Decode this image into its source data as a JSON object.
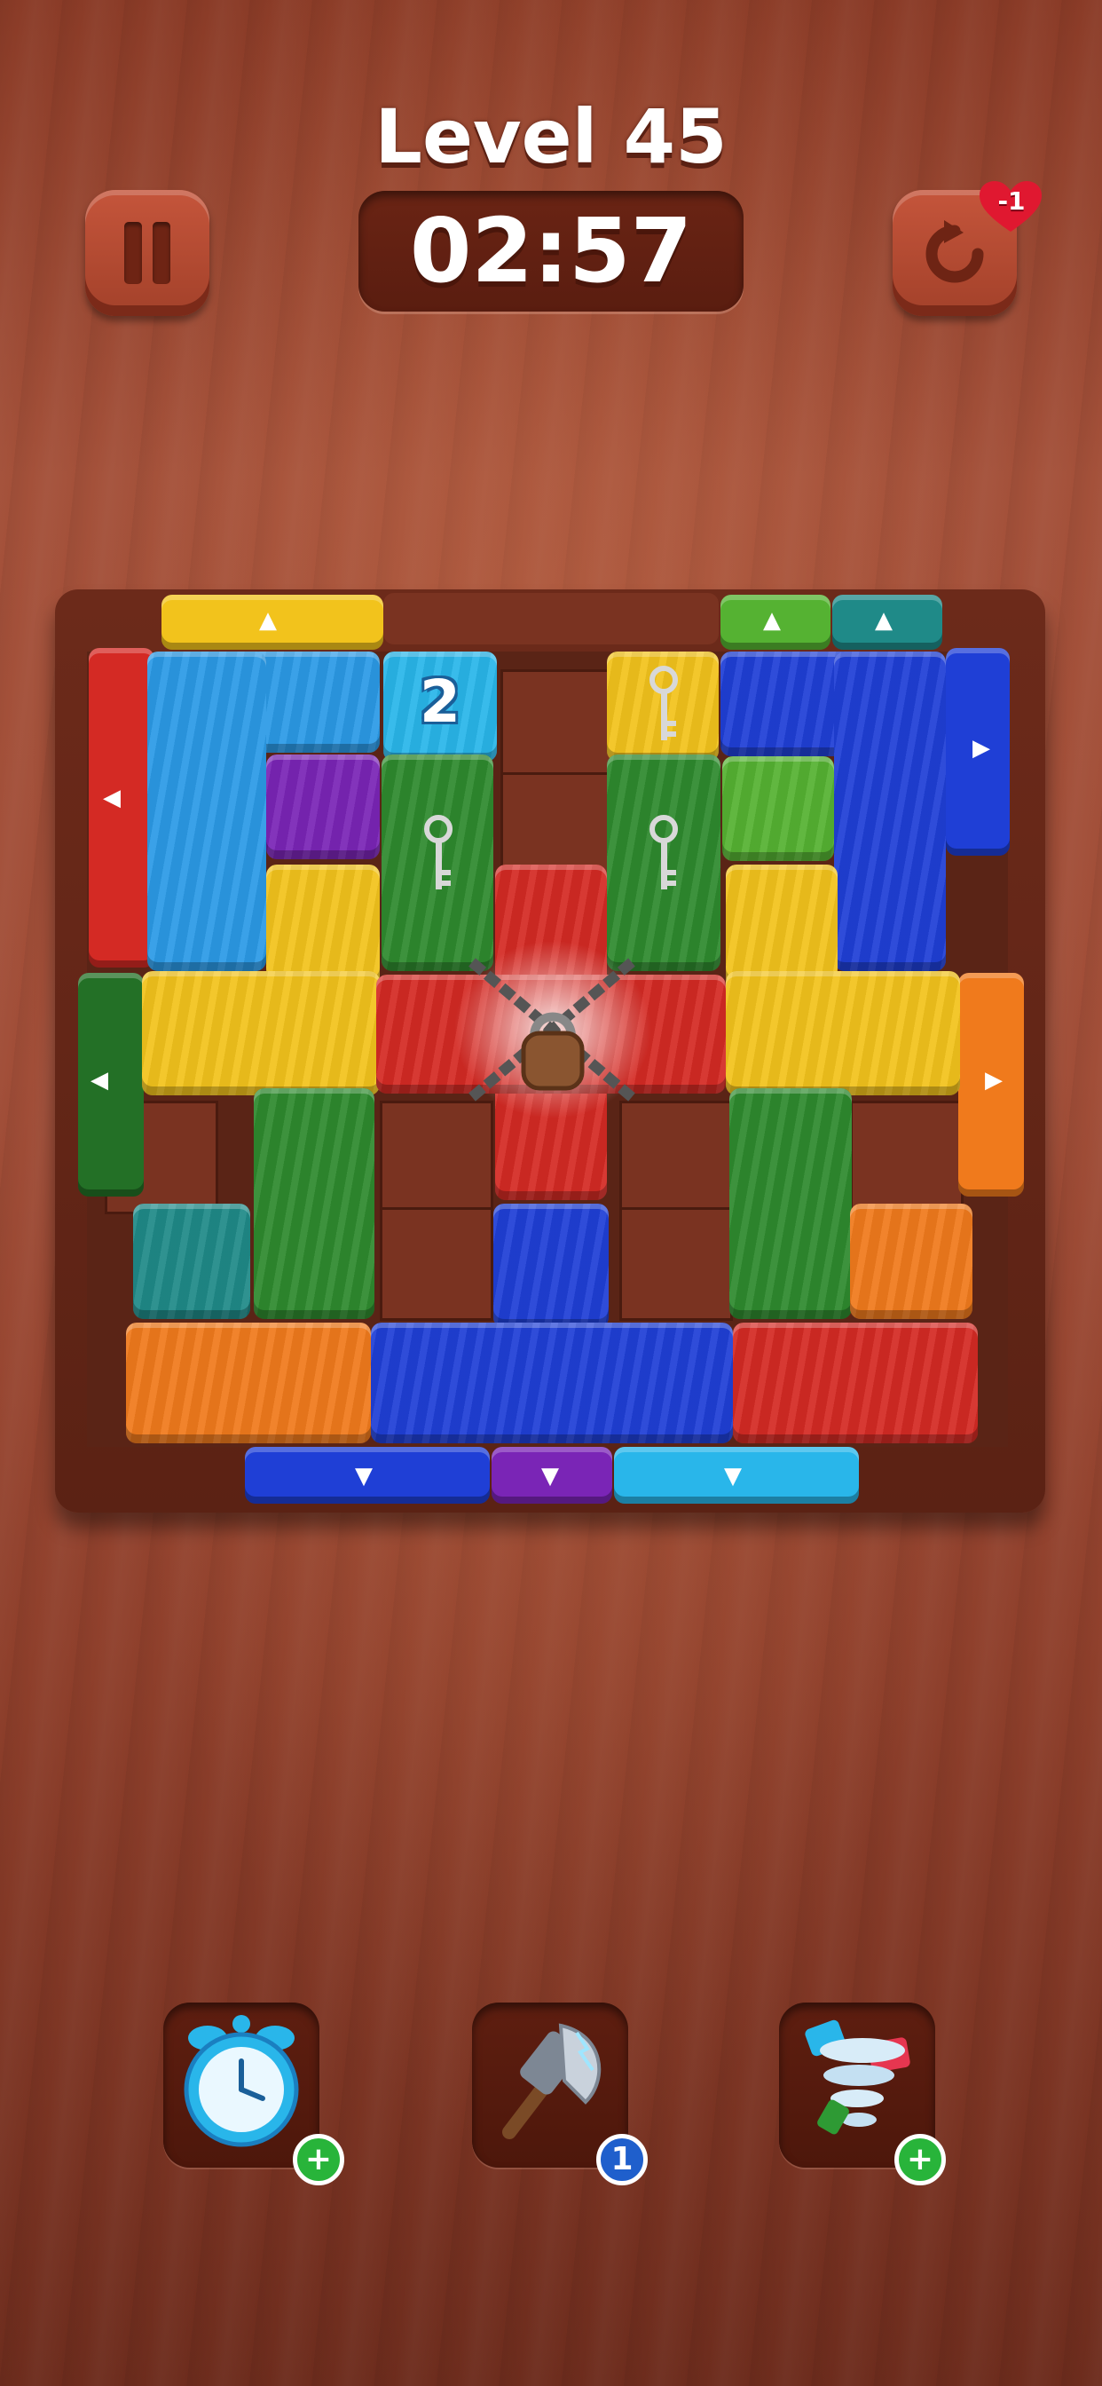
{
  "header": {
    "level_title": "Level 45",
    "timer": "02:57",
    "lives_change": "-1"
  },
  "colors": {
    "red": "#d42a24",
    "blue": "#1f3fd6",
    "light_blue": "#2b9ae6",
    "cyan": "#29b6ea",
    "yellow": "#f2c31c",
    "green": "#2e8a2e",
    "light_green": "#55b232",
    "dark_green": "#237026",
    "teal": "#1f8a88",
    "purple": "#7a25b6",
    "orange": "#f07a1c"
  },
  "board": {
    "counter_block_value": "2",
    "locked_center_icon": "chain-padlock-icon"
  },
  "powerups": [
    {
      "name": "alarm-clock",
      "icon": "alarm-clock-icon",
      "badge": "+"
    },
    {
      "name": "hammer",
      "icon": "hammer-icon",
      "badge": "1"
    },
    {
      "name": "tornado-shuffle",
      "icon": "tornado-icon",
      "badge": "+"
    }
  ]
}
